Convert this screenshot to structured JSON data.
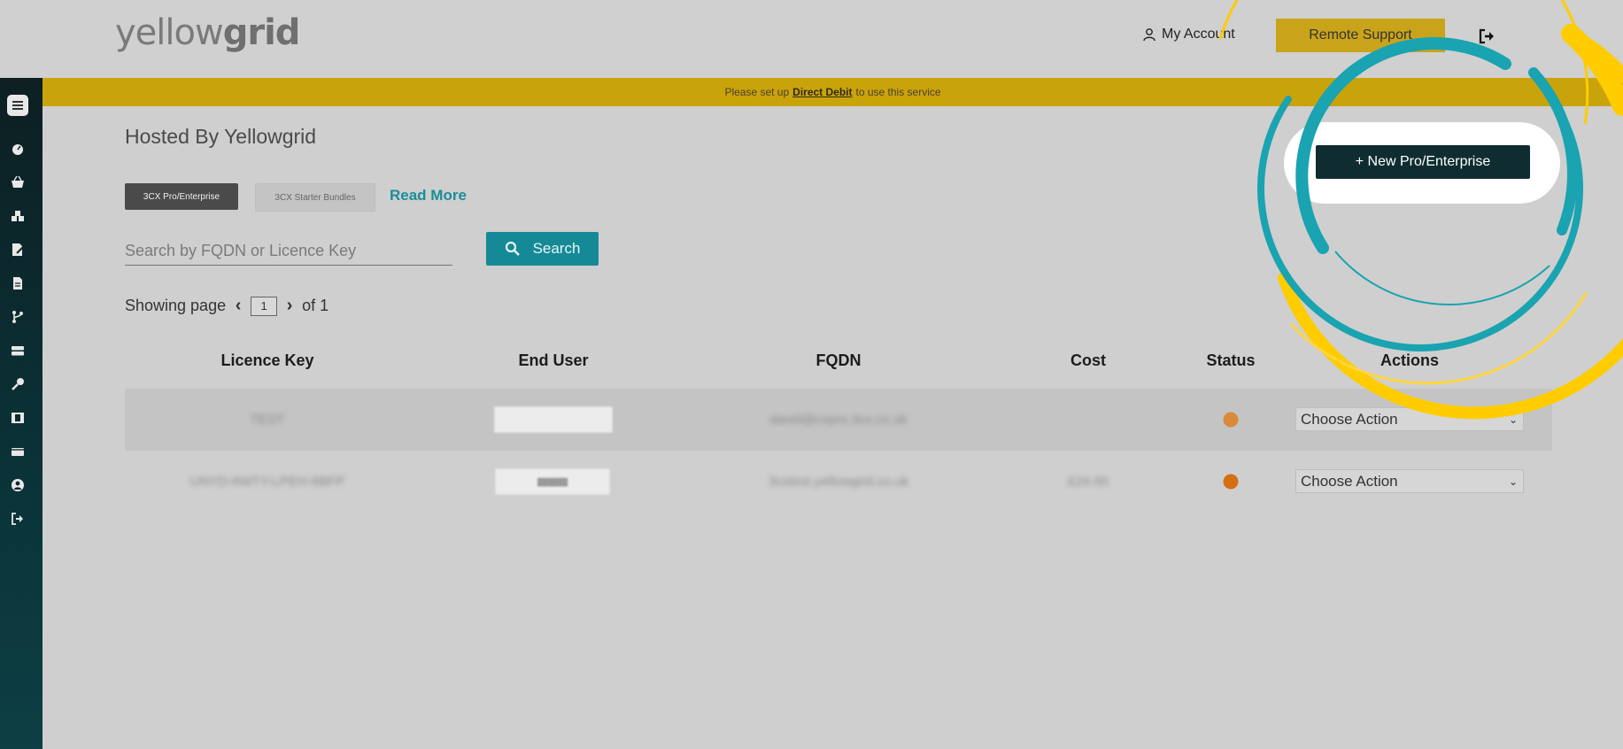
{
  "header": {
    "logo_light": "yellow",
    "logo_bold": "grid",
    "my_account": "My Account",
    "remote_support": "Remote Support"
  },
  "banner": {
    "prefix": "Please set up",
    "link": "Direct Debit",
    "suffix": "to use this service"
  },
  "page": {
    "title": "Hosted By Yellowgrid",
    "tabs": [
      "3CX Pro/Enterprise",
      "3CX Starter Bundles"
    ],
    "read_more": "Read More",
    "new_button": "+ New Pro/Enterprise"
  },
  "search": {
    "placeholder": "Search by FQDN or Licence Key",
    "button_label": "Search"
  },
  "pager": {
    "prefix": "Showing page",
    "current_page": "1",
    "suffix": "of 1"
  },
  "table": {
    "headers": [
      "Licence Key",
      "End User",
      "FQDN",
      "Cost",
      "Status",
      "Actions"
    ],
    "rows": [
      {
        "licence_key": "TEST",
        "end_user": "",
        "fqdn": "david@cxpro.3cx.co.uk",
        "cost": "",
        "status_color": "#d88a3a",
        "action": "Choose Action"
      },
      {
        "licence_key": "UNYD-6WTY-LPEH-6BFP",
        "end_user": "██████",
        "fqdn": "3cxtest.yellowgrid.co.uk",
        "cost": "£24.00",
        "status_color": "#d46f14",
        "action": "Choose Action"
      }
    ]
  },
  "colors": {
    "accent_teal": "#158a96",
    "accent_yellow": "#c9a30a",
    "highlight_ring_yellow": "#ffcc00",
    "highlight_ring_teal": "#1aa3b0"
  },
  "sidebar": {
    "icons": [
      "menu-icon",
      "dashboard-icon",
      "basket-icon",
      "boxes-icon",
      "edit-document-icon",
      "document-icon",
      "branch-icon",
      "server-icon",
      "key-icon",
      "film-icon",
      "card-icon",
      "user-circle-icon",
      "logout-icon"
    ]
  }
}
